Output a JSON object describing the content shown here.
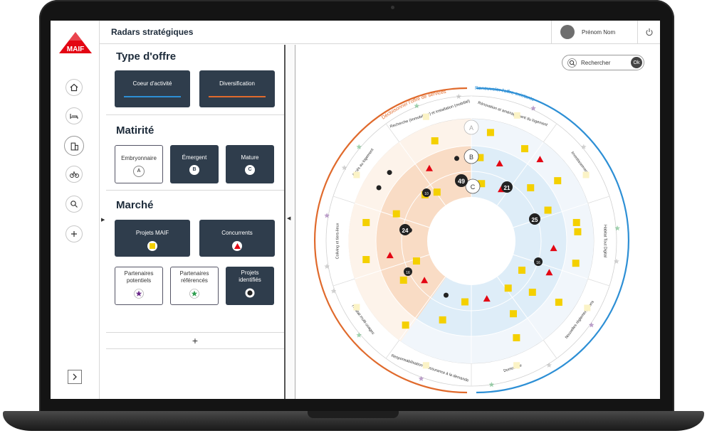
{
  "header": {
    "title": "Radars stratégiques",
    "user_name": "Prénom Nom"
  },
  "brand": {
    "logo_text": "MAIF"
  },
  "colors": {
    "navy": "#2f3d4c",
    "red": "#e30613",
    "orange": "#e06a2c",
    "blue": "#2d8fd5",
    "yellow": "#f4d000"
  },
  "filters": {
    "type_offre": {
      "title": "Type d'offre",
      "options": [
        {
          "label": "Coeur d'activité"
        },
        {
          "label": "Diversification"
        }
      ]
    },
    "maturite": {
      "title": "Matirité",
      "options": [
        {
          "label": "Embryonnaire",
          "badge": "A"
        },
        {
          "label": "Émergent",
          "badge": "B"
        },
        {
          "label": "Mature",
          "badge": "C"
        }
      ]
    },
    "marche": {
      "title": "Marché",
      "options": [
        {
          "label": "Projets MAIF"
        },
        {
          "label": "Concurrents"
        },
        {
          "label": "Partenaires potentiels"
        },
        {
          "label": "Partenaires référencés"
        },
        {
          "label": "Projets identifiés"
        }
      ]
    },
    "add_label": "+"
  },
  "search": {
    "label": "Rechercher",
    "ok": "Ok"
  },
  "radar": {
    "arc_left_title": "Décloisonner l'offre de services",
    "arc_right_title": "Renouveler l'offre existante",
    "rings": [
      "A",
      "B",
      "C"
    ],
    "sectors": [
      "Rénovation et aménagement du logement",
      "Investissement",
      "Habitat Tout Digital",
      "Nouvelles réglementations",
      "Domotique",
      "Responsabilisation et assurance à la demande",
      "Habitat multi-usages",
      "Coliving et tiers-lieux",
      "Accès au logement",
      "Recherche (immobilière) et installation (mobilité)"
    ],
    "counts": {
      "top": "49",
      "right": "21",
      "right2": "25",
      "left": "24",
      "left2": "10",
      "left3": "16",
      "right3": "16"
    }
  }
}
